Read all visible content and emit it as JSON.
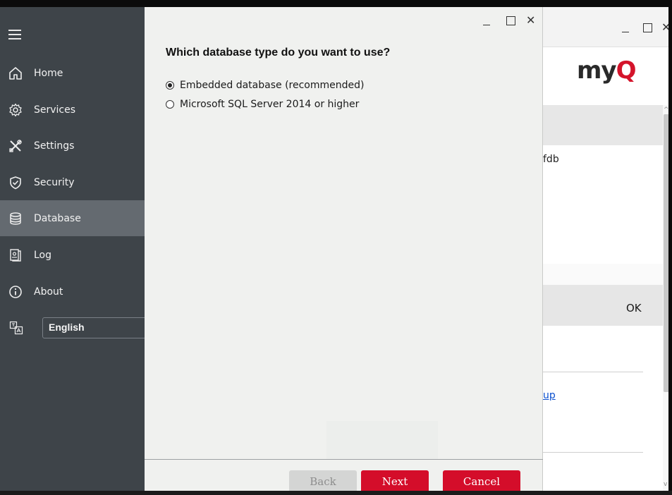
{
  "sidebar": {
    "items": [
      {
        "label": "Home",
        "icon": "home-icon"
      },
      {
        "label": "Services",
        "icon": "gear-icon"
      },
      {
        "label": "Settings",
        "icon": "tools-icon"
      },
      {
        "label": "Security",
        "icon": "shield-icon"
      },
      {
        "label": "Database",
        "icon": "database-icon",
        "active": true
      },
      {
        "label": "Log",
        "icon": "log-icon"
      },
      {
        "label": "About",
        "icon": "info-icon"
      }
    ],
    "language": "English"
  },
  "dialog": {
    "question": "Which database type do you want to use?",
    "options": [
      {
        "label": "Embedded database (recommended)",
        "selected": true
      },
      {
        "label": "Microsoft SQL Server 2014 or higher",
        "selected": false
      }
    ],
    "buttons": {
      "back": "Back",
      "next": "Next",
      "cancel": "Cancel"
    }
  },
  "background_window": {
    "logo_part1": "my",
    "logo_part2": "Q",
    "fragment_db": "fdb",
    "ok_label": "OK",
    "link_fragment": "up"
  },
  "colors": {
    "sidebar_bg": "#3e4449",
    "sidebar_active": "#646a70",
    "accent_red": "#d40d2a",
    "dialog_bg": "#f0f1ef"
  }
}
